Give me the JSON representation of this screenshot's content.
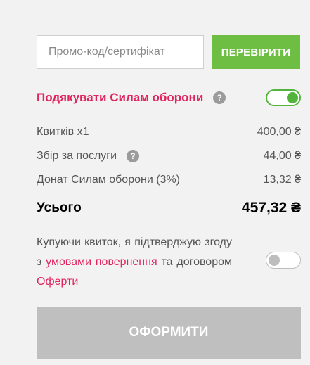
{
  "promo": {
    "placeholder": "Промо-код/сертифікат",
    "value": "",
    "button_label": "ПЕРЕВІРИТИ"
  },
  "donate": {
    "label": "Подякувати Силам оборони",
    "help": "?",
    "enabled": true
  },
  "summary": {
    "tickets": {
      "label": "Квитків x1",
      "amount": "400,00 ₴"
    },
    "service_fee": {
      "label": "Збір за послуги",
      "help": "?",
      "amount": "44,00 ₴"
    },
    "donation": {
      "label": "Донат Силам оборони (3%)",
      "amount": "13,32 ₴"
    },
    "total": {
      "label": "Усього",
      "amount": "457,32 ₴"
    }
  },
  "agreement": {
    "text_1": "Купуючи квиток, я підтверджую згоду з ",
    "link_refund": "умовами повернення",
    "text_2": " та договором ",
    "link_offer": "Оферти",
    "enabled": false
  },
  "checkout": {
    "label": "ОФОРМИТИ",
    "disabled": true
  },
  "colors": {
    "accent": "#e0245e",
    "green": "#6fbe44",
    "disabled": "#bfbfbf"
  }
}
